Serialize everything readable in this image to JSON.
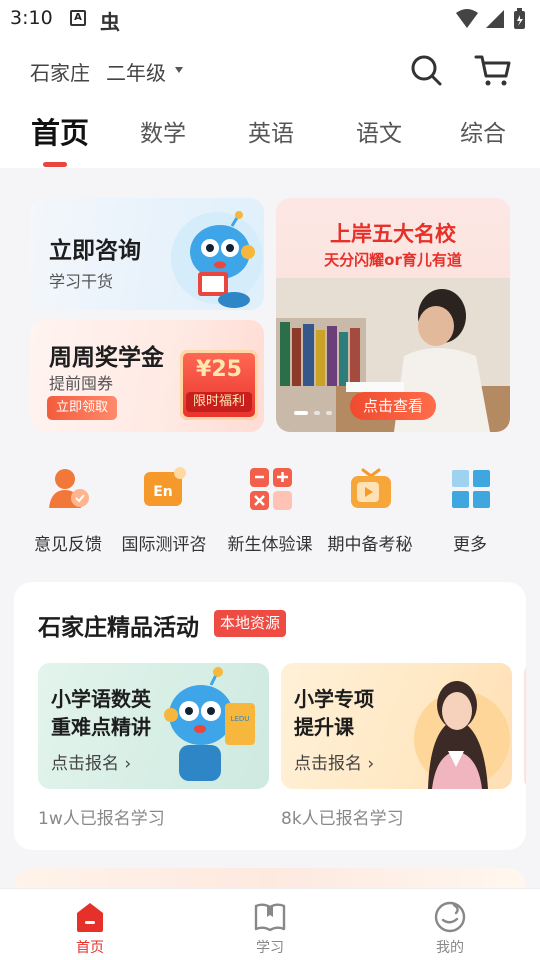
{
  "status_bar": {
    "time": "3:10",
    "notification_a": "A",
    "notification_b": "虫"
  },
  "header": {
    "location": "石家庄",
    "grade": "二年级",
    "search_icon": "search-icon",
    "cart_icon": "cart-icon"
  },
  "tabs": [
    {
      "label": "首页",
      "active": true
    },
    {
      "label": "数学",
      "active": false
    },
    {
      "label": "英语",
      "active": false
    },
    {
      "label": "语文",
      "active": false
    },
    {
      "label": "综合",
      "active": false
    }
  ],
  "promo": {
    "consult": {
      "title": "立即咨询",
      "subtitle": "学习干货"
    },
    "scholarship": {
      "title": "周周奖学金",
      "subtitle": "提前囤券",
      "button": "立即领取",
      "coupon_amount": "¥25",
      "coupon_label": "限时福利"
    },
    "banner": {
      "title": "上岸五大名校",
      "subtitle": "天分闪耀or育儿有道",
      "button": "点击查看",
      "slide_count": 3,
      "active_slide": 1
    }
  },
  "quick_links": [
    {
      "label": "意见反馈",
      "icon": "feedback-person-icon"
    },
    {
      "label": "国际测评咨",
      "icon": "english-test-icon",
      "icon_text": "En"
    },
    {
      "label": "新生体验课",
      "icon": "calculator-icon"
    },
    {
      "label": "期中备考秘",
      "icon": "video-tv-icon"
    },
    {
      "label": "更多",
      "icon": "grid-more-icon"
    }
  ],
  "activities": {
    "title": "石家庄精品活动",
    "badge": "本地资源",
    "courses": [
      {
        "line1": "小学语数英",
        "line2": "重难点精讲",
        "link": "点击报名",
        "enrolled": "1w人已报名学习"
      },
      {
        "line1": "小学专项",
        "line2": "提升课",
        "link": "点击报名",
        "enrolled": "8k人已报名学习"
      }
    ]
  },
  "bottom_nav": [
    {
      "label": "首页",
      "icon": "home-icon",
      "active": true
    },
    {
      "label": "学习",
      "icon": "book-icon",
      "active": false
    },
    {
      "label": "我的",
      "icon": "profile-face-icon",
      "active": false
    }
  ],
  "colors": {
    "accent": "#e6312a",
    "badge": "#ee4b43",
    "tab_indicator": "#e8463e"
  }
}
